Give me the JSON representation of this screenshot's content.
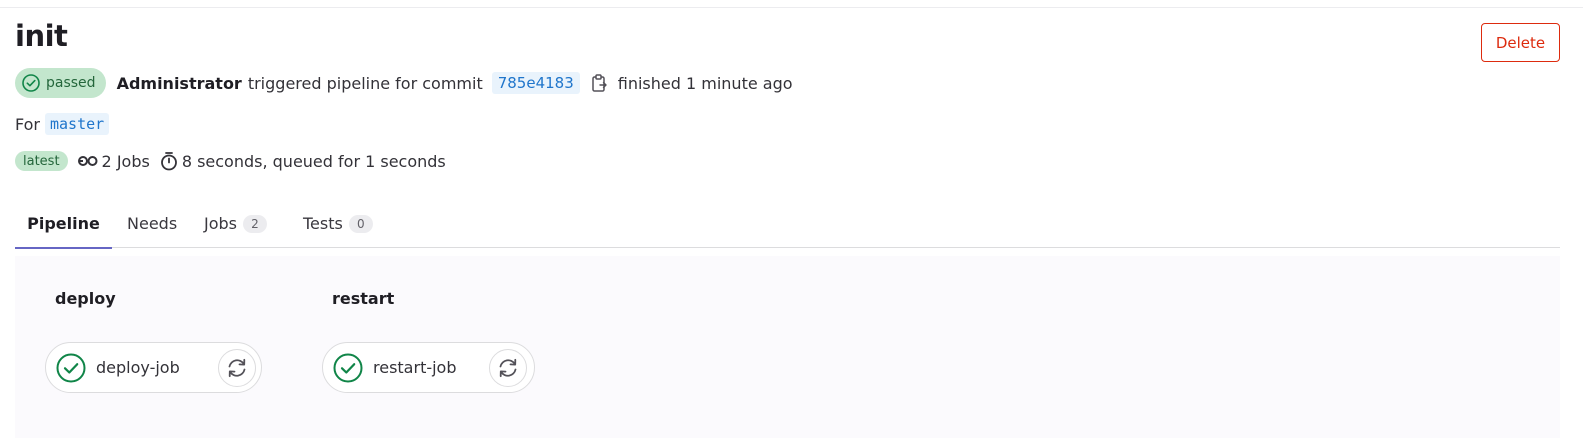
{
  "pipeline": {
    "title": "init",
    "delete_label": "Delete",
    "status_label": "passed",
    "user": "Administrator",
    "triggered_text": "triggered pipeline for commit",
    "commit_sha": "785e4183",
    "finished_text": "finished 1 minute ago",
    "for_label": "For",
    "ref": "master",
    "latest_label": "latest",
    "jobs_text": "2 Jobs",
    "duration_text": "8 seconds, queued for 1 seconds"
  },
  "tabs": [
    {
      "label": "Pipeline",
      "count": null,
      "active": true
    },
    {
      "label": "Needs",
      "count": null,
      "active": false
    },
    {
      "label": "Jobs",
      "count": "2",
      "active": false
    },
    {
      "label": "Tests",
      "count": "0",
      "active": false
    }
  ],
  "stages": [
    {
      "name": "deploy",
      "job": {
        "name": "deploy-job",
        "status": "success"
      }
    },
    {
      "name": "restart",
      "job": {
        "name": "restart-job",
        "status": "success"
      }
    }
  ],
  "colors": {
    "success": "#108548",
    "danger": "#dd2b0e",
    "link": "#1f75cb",
    "tab_indicator": "#6666c4"
  },
  "icons": {
    "status": "status-success-icon",
    "copy": "copy-to-clipboard-icon",
    "jobs": "pipeline-jobs-icon",
    "timer": "timer-icon",
    "retry": "retry-icon"
  }
}
